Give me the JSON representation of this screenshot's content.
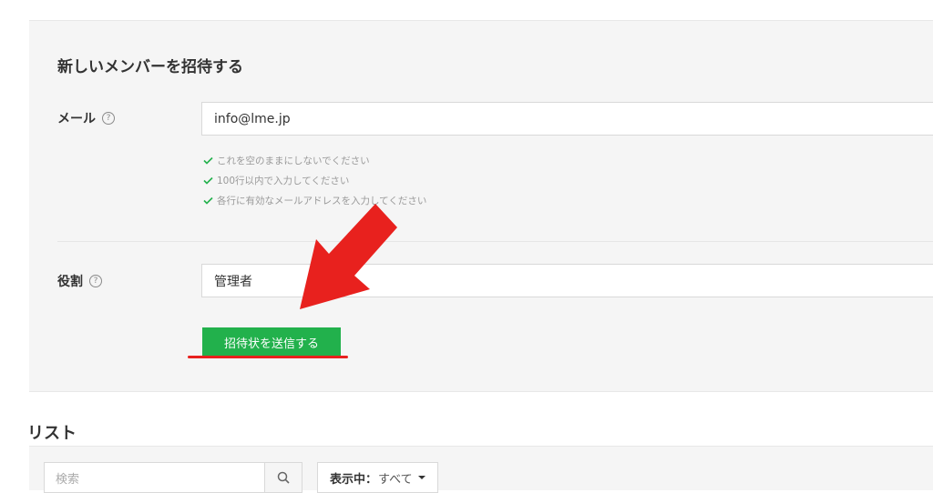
{
  "invite_form": {
    "title": "新しいメンバーを招待する",
    "email_label": "メール",
    "email_value": "info@lme.jp",
    "help_glyph": "?",
    "validation_rules": [
      "これを空のままにしないでください",
      "100行以内で入力してください",
      "各行に有効なメールアドレスを入力してください"
    ],
    "role_label": "役割",
    "role_value": "管理者",
    "send_button_label": "招待状を送信する"
  },
  "list_section": {
    "title": "リスト",
    "search_placeholder": "検索",
    "filter_label": "表示中：",
    "filter_value": "すべて"
  },
  "icons": {
    "help": "question-circle-icon",
    "check": "check-icon",
    "search": "search-icon",
    "dropdown": "caret-down-icon"
  },
  "colors": {
    "primary_button": "#22b14c",
    "annotation": "#e8211e",
    "check": "#22b14c"
  }
}
